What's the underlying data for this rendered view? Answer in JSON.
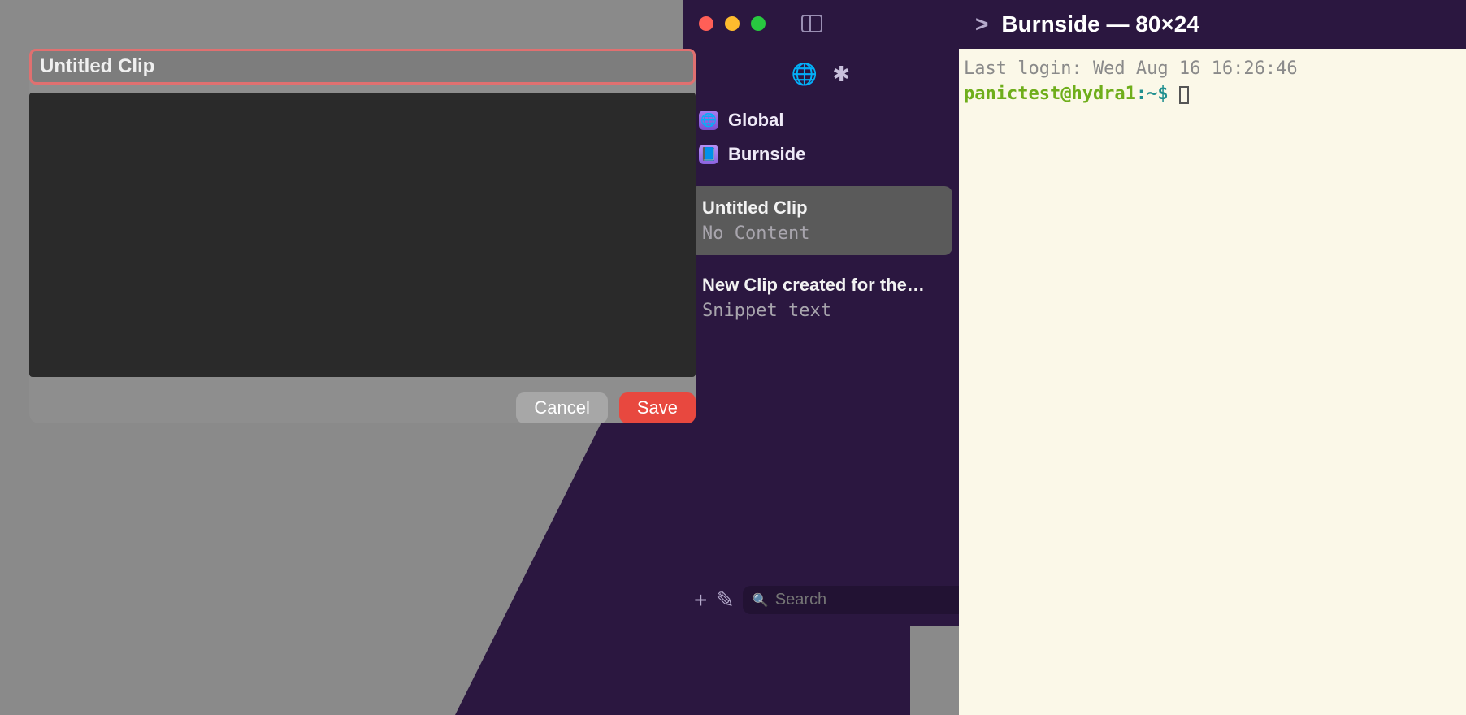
{
  "clip_editor": {
    "title_value": "Untitled Clip",
    "body_value": "",
    "cancel_label": "Cancel",
    "save_label": "Save"
  },
  "sidebar": {
    "header_globe": "🌐",
    "header_star": "✱",
    "nav": [
      {
        "label": "Global",
        "icon": "globe"
      },
      {
        "label": "Burnside",
        "icon": "book"
      }
    ],
    "clips": [
      {
        "title": "Untitled Clip",
        "sub": "No Content",
        "selected": true
      },
      {
        "title": "New Clip created for the…",
        "sub": "Snippet text",
        "selected": false
      }
    ],
    "add_glyph": "+",
    "edit_glyph": "✎",
    "search_placeholder": "Search",
    "search_icon": "🔍"
  },
  "terminal": {
    "title": "Burnside — 80×24",
    "caret": ">",
    "last_login": "Last login: Wed Aug 16 16:26:46",
    "prompt_user": "panictest@hydra1",
    "prompt_sep": ":",
    "prompt_path": "~",
    "prompt_dollar": "$"
  }
}
